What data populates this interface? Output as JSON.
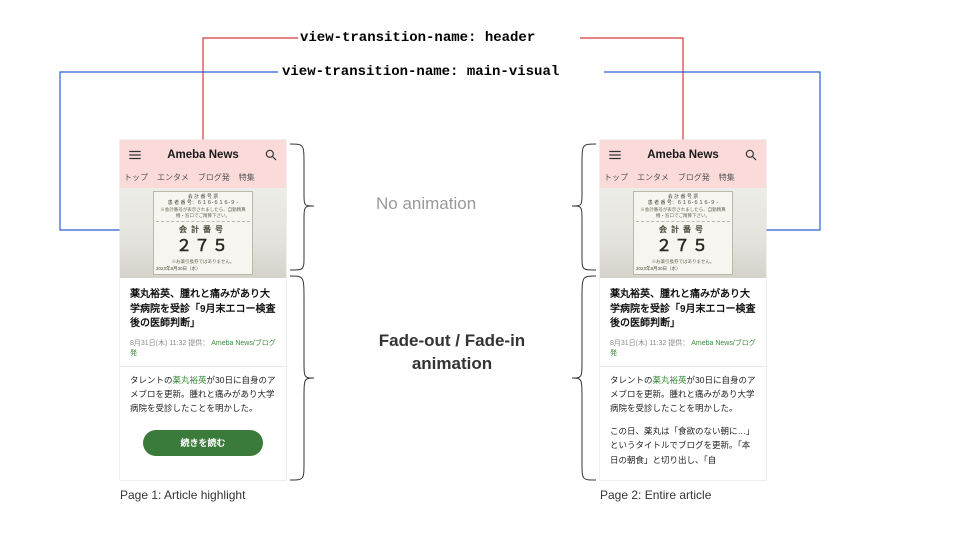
{
  "labels": {
    "header": "view-transition-name: header",
    "main_visual": "view-transition-name: main-visual"
  },
  "annotations": {
    "no_animation": "No animation",
    "fade": "Fade-out / Fade-in animation"
  },
  "captions": {
    "page1": "Page 1: Article highlight",
    "page2": "Page 2: Entire article"
  },
  "phone_common": {
    "site_title": "Ameba News",
    "tabs": [
      "トップ",
      "エンタメ",
      "ブログ発",
      "特集"
    ],
    "ticket": {
      "line1": "会 計 番 号 票",
      "line2": "患 者 番 号：６１６-６１６-９ -",
      "line3": "※会計番号が表示されましたら、自動精算機・窓口でご精算下さい。",
      "label": "会計番号",
      "number": "２７５",
      "note": "※お薬引換券ではありません。",
      "date_left": "2023年8月30日（水）"
    },
    "headline": "薬丸裕英、腫れと痛みがあり大学病院を受診「9月末エコー検査後の医師判断」",
    "meta_date": "8月31日(木) 11:32",
    "meta_mid": "提供：",
    "meta_source": "Ameba News/ブログ発",
    "body1_prefix": "タレントの",
    "body1_link": "薬丸裕英",
    "body1_suffix": "が30日に自身のアメブロを更新。腫れと痛みがあり大学病院を受診したことを明かした。"
  },
  "phone1": {
    "cta": "続きを読む"
  },
  "phone2": {
    "body2": "この日、薬丸は「食欲のない朝に…」というタイトルでブログを更新。「本日の朝食」と切り出し、「自"
  }
}
